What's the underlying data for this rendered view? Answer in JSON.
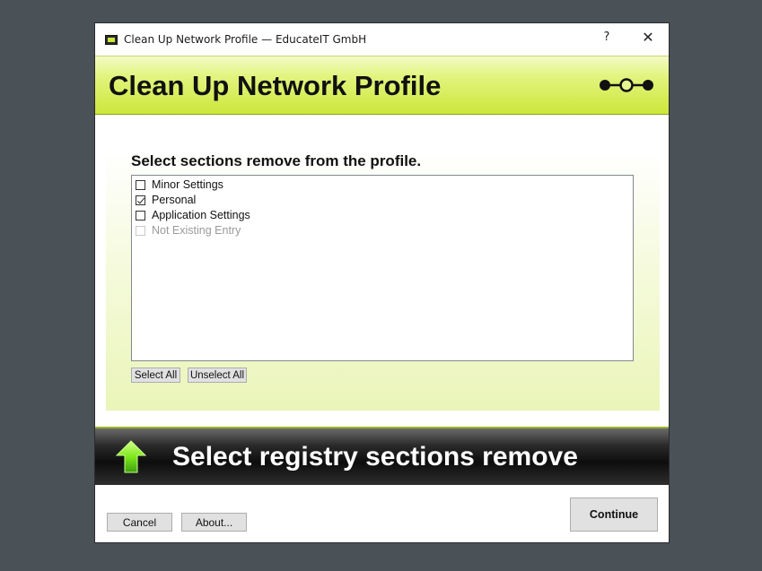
{
  "window": {
    "title": "Clean Up Network Profile — EducateIT GmbH",
    "help_glyph": "?",
    "close_glyph": "✕"
  },
  "header": {
    "title": "Clean Up Network Profile"
  },
  "content": {
    "heading": "Select sections remove from the profile.",
    "items": [
      {
        "label": "Minor Settings",
        "checked": false,
        "enabled": true
      },
      {
        "label": "Personal",
        "checked": true,
        "enabled": true
      },
      {
        "label": "Application Settings",
        "checked": false,
        "enabled": true
      },
      {
        "label": "Not Existing Entry",
        "checked": false,
        "enabled": false
      }
    ],
    "select_all_label": "Select All",
    "unselect_all_label": "Unselect All"
  },
  "banner": {
    "text": "Select registry sections remove"
  },
  "footer": {
    "cancel_label": "Cancel",
    "about_label": "About...",
    "continue_label": "Continue"
  },
  "colors": {
    "accent": "#cde73a",
    "banner_bg": "#0d0d0d",
    "arrow_green": "#7ee81c"
  }
}
